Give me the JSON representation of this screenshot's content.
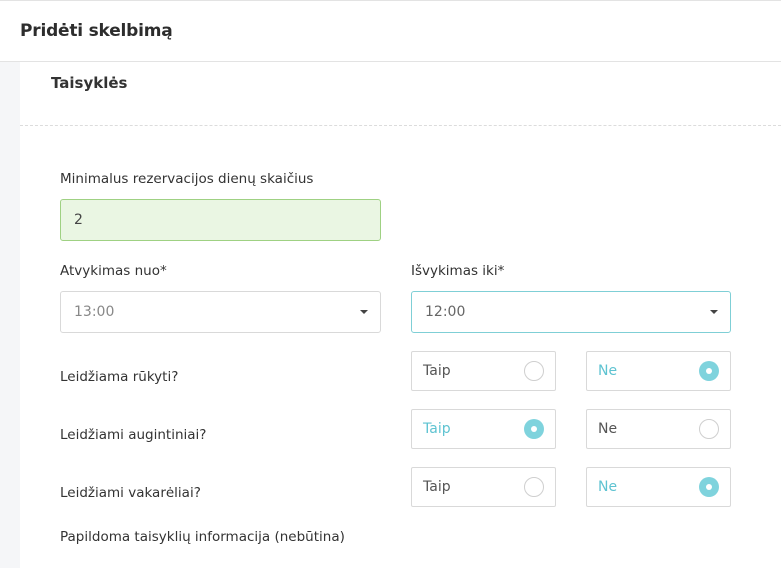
{
  "header": {
    "title": "Pridėti skelbimą"
  },
  "section": {
    "title": "Taisyklės"
  },
  "min_days": {
    "label": "Minimalus rezervacijos dienų skaičius",
    "value": "2"
  },
  "check_in": {
    "label": "Atvykimas nuo*",
    "value": "13:00"
  },
  "check_out": {
    "label": "Išvykimas iki*",
    "value": "12:00"
  },
  "rules": [
    {
      "label": "Leidžiama rūkyti?",
      "yes": "Taip",
      "no": "Ne",
      "selected": "no"
    },
    {
      "label": "Leidžiami augintiniai?",
      "yes": "Taip",
      "no": "Ne",
      "selected": "yes"
    },
    {
      "label": "Leidžiami vakarėliai?",
      "yes": "Taip",
      "no": "Ne",
      "selected": "no"
    }
  ],
  "extra_info": {
    "label": "Papildoma taisyklių informacija (nebūtina)"
  },
  "colors": {
    "accent": "#7fd3dd",
    "success_bg": "#eaf6e3",
    "success_border": "#9fd183"
  }
}
